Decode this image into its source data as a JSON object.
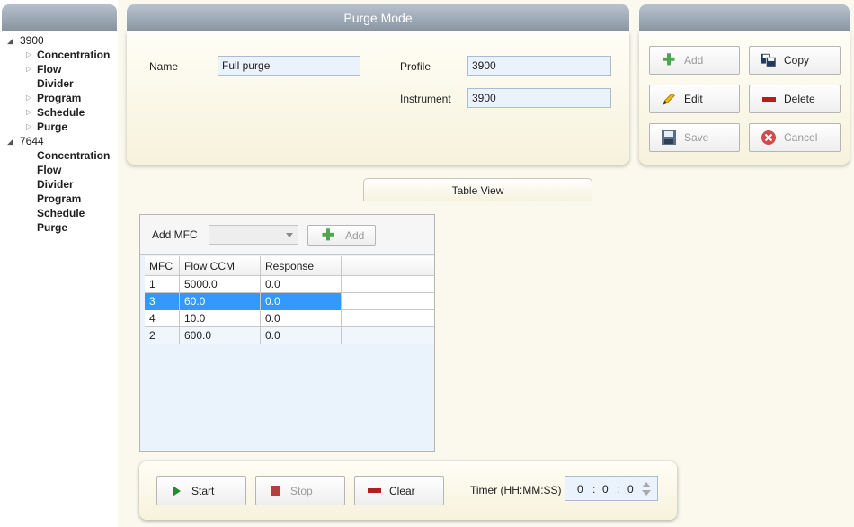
{
  "tree": {
    "roots": [
      {
        "label": "3900",
        "expanded": true,
        "children": [
          {
            "label": "Concentration",
            "expandable": true
          },
          {
            "label": "Flow",
            "expandable": true
          },
          {
            "label": "Divider",
            "expandable": false
          },
          {
            "label": "Program",
            "expandable": true
          },
          {
            "label": "Schedule",
            "expandable": true
          },
          {
            "label": "Purge",
            "expandable": true
          }
        ]
      },
      {
        "label": "7644",
        "expanded": true,
        "children": [
          {
            "label": "Concentration",
            "expandable": false
          },
          {
            "label": "Flow",
            "expandable": false
          },
          {
            "label": "Divider",
            "expandable": false
          },
          {
            "label": "Program",
            "expandable": false
          },
          {
            "label": "Schedule",
            "expandable": false
          },
          {
            "label": "Purge",
            "expandable": false
          }
        ]
      }
    ]
  },
  "purge_panel": {
    "title": "Purge Mode",
    "name_label": "Name",
    "name_value": "Full purge",
    "profile_label": "Profile",
    "profile_value": "3900",
    "instrument_label": "Instrument",
    "instrument_value": "3900"
  },
  "actions": {
    "add": "Add",
    "copy": "Copy",
    "edit": "Edit",
    "delete": "Delete",
    "save": "Save",
    "cancel": "Cancel"
  },
  "tabs": {
    "table_view": "Table View"
  },
  "mfc_toolbar": {
    "add_mfc_label": "Add MFC",
    "selected_mfc": "",
    "add_button": "Add"
  },
  "grid": {
    "columns": [
      "MFC",
      "Flow CCM",
      "Response"
    ],
    "rows": [
      {
        "mfc": "1",
        "flow": "5000.0",
        "response": "0.0"
      },
      {
        "mfc": "3",
        "flow": "60.0",
        "response": "0.0"
      },
      {
        "mfc": "4",
        "flow": "10.0",
        "response": "0.0"
      },
      {
        "mfc": "2",
        "flow": "600.0",
        "response": "0.0"
      }
    ],
    "selected_row": 1
  },
  "run_panel": {
    "start": "Start",
    "stop": "Stop",
    "clear": "Clear",
    "timer_label": "Timer (HH:MM:SS)",
    "timer_hh": "0",
    "timer_mm": "0",
    "timer_ss": "0",
    "timer_sep": ":"
  },
  "colors": {
    "header_gradient_top": "#b8c2ce",
    "header_gradient_bottom": "#8995a3",
    "panel_background": "#fffef6",
    "selection": "#3399ff",
    "add_green": "#1a8a1a",
    "delete_red": "#b21e1e"
  },
  "icons": {
    "add": "plus-icon",
    "copy": "copy-icon",
    "edit": "pencil-icon",
    "delete": "minus-icon",
    "save": "floppy-icon",
    "cancel": "cancel-icon",
    "start": "play-icon",
    "stop": "stop-icon",
    "clear": "minus-icon"
  }
}
